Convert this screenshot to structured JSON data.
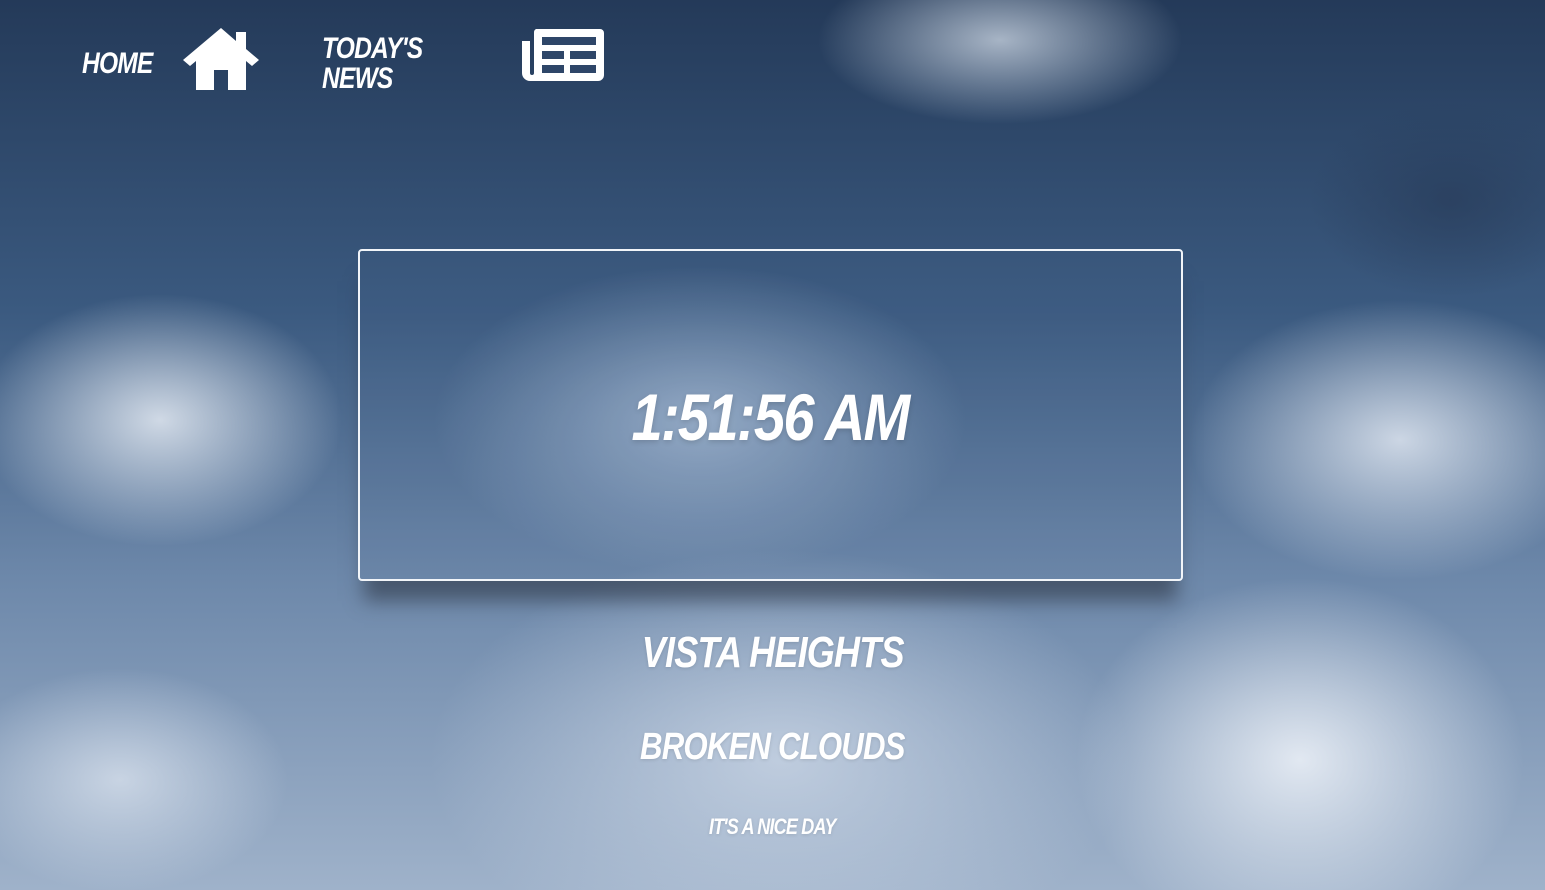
{
  "nav": {
    "home_label": "Home",
    "home_icon": "home-icon",
    "news_label": "Today's News",
    "news_icon": "newspaper-icon"
  },
  "clock": {
    "time": "1:51:56 AM"
  },
  "weather": {
    "location": "Vista Heights",
    "condition": "Broken Clouds",
    "message": "It's a nice day"
  },
  "colors": {
    "text": "#ffffff",
    "box_border": "#f2f5f9",
    "sky_top": "#243a59",
    "sky_bottom": "#9fb2ca"
  }
}
